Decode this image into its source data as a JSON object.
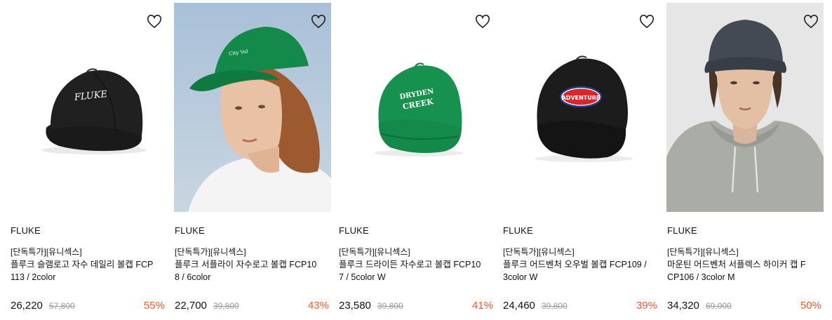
{
  "products": [
    {
      "brand": "FLUKE",
      "tag": "[단독특가][유니섹스]",
      "title_line1": "플루크 슬램로고 자수 데일리 볼캡 FCP",
      "title_line2": "113 / 2color",
      "price": "26,220",
      "original_price": "57,800",
      "discount": "55%"
    },
    {
      "brand": "FLUKE",
      "tag": "[단독특가][유니섹스]",
      "title_line1": "플루크 서플라이 자수로고 볼캡 FCP10",
      "title_line2": "8 / 6color",
      "price": "22,700",
      "original_price": "39,800",
      "discount": "43%"
    },
    {
      "brand": "FLUKE",
      "tag": "[단독특가][유니섹스]",
      "title_line1": "플루크 드라이든 자수로고 볼캡 FCP10",
      "title_line2": "7 / 5color W",
      "price": "23,580",
      "original_price": "39,800",
      "discount": "41%"
    },
    {
      "brand": "FLUKE",
      "tag": "[단독특가][유니섹스]",
      "title_line1": "플루크 어드벤처 오우벌 볼캡 FCP109 /",
      "title_line2": "3color W",
      "price": "24,460",
      "original_price": "39,800",
      "discount": "39%"
    },
    {
      "brand": "FLUKE",
      "tag": "[단독특가][유니섹스]",
      "title_line1": "마운틴 어드벤처 서플렉스 하이커 캡 F",
      "title_line2": "CP106 / 3color M",
      "price": "34,320",
      "original_price": "69,000",
      "discount": "50%"
    }
  ],
  "image_text": {
    "cap1_logo": "FLUKE",
    "cap3_line1": "DRYDEN",
    "cap3_line2": "CREEK",
    "cap4_badge": "ADVENTURE"
  },
  "colors": {
    "discount": "#f05a28",
    "original_price": "#9a9a9a"
  },
  "icons": {
    "wishlist": "heart-outline-icon"
  }
}
